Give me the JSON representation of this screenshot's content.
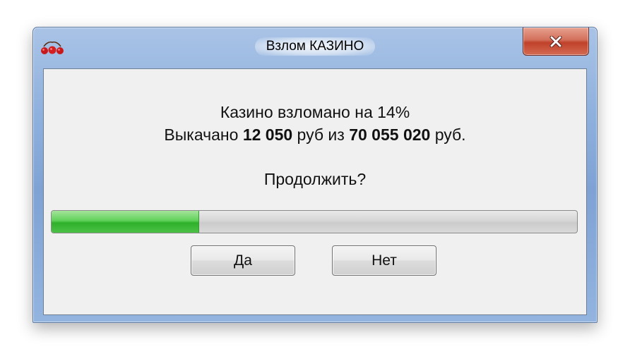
{
  "window": {
    "title": "Взлом КАЗИНО",
    "app_icon": "cherries-icon",
    "close_icon": "close-icon"
  },
  "message": {
    "line1": "Казино взломано на 14%",
    "line2_prefix": "Выкачано ",
    "line2_amount": "12 050",
    "line2_mid": " руб из ",
    "line2_total": "70 055 020",
    "line2_suffix": " руб.",
    "question": "Продолжить?"
  },
  "progress": {
    "fraction": 0.28
  },
  "buttons": {
    "yes_label": "Да",
    "no_label": "Нет"
  },
  "colors": {
    "progress_fill": "#4cc146",
    "close_button": "#c0412a",
    "frame": "#8eb0dd"
  }
}
